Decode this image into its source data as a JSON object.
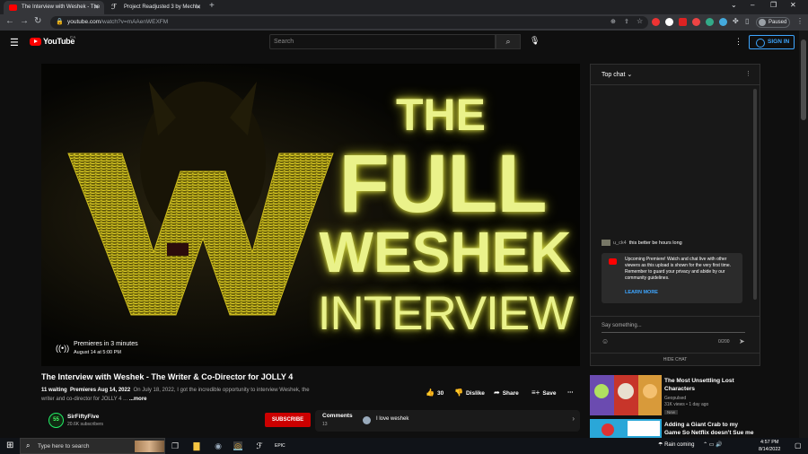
{
  "browser": {
    "tabs": [
      {
        "title": "The Interview with Weshek - The",
        "active": true
      },
      {
        "title": "Project Readjusted 3 by Mechlu",
        "active": false
      }
    ],
    "new_tab": "+",
    "url_host": "youtube.com",
    "url_path": "/watch?v=mAAenWEXFM",
    "profile_label": "Paused",
    "window_controls": [
      "–",
      "❐",
      "✕"
    ]
  },
  "youtube": {
    "logo_text": "YouTube",
    "logo_country": "CA",
    "search_placeholder": "Search",
    "sign_in": "SIGN IN"
  },
  "player": {
    "thumbnail_lines": [
      "THE",
      "FULL",
      "WESHEK",
      "INTERVIEW"
    ],
    "thumbnail_letter": "W",
    "premiere_status": "Premieres in 3 minutes",
    "premiere_time": "August 14 at 5:00 PM"
  },
  "video": {
    "title": "The Interview with Weshek - The Writer & Co-Director for JOLLY 4",
    "waiting": "11 waiting",
    "premieres": "Premieres Aug 14, 2022",
    "description": "On July 18, 2022, I got the incredible opportunity to interview Weshek, the writer and co-director for JOLLY 4 ...",
    "more": "...more",
    "likes": "30",
    "dislike_label": "Dislike",
    "share_label": "Share",
    "save_label": "Save",
    "channel_name": "SirFiftyFive",
    "channel_initials": "55",
    "subscribers": "20.6K subscribers",
    "subscribe_label": "SUBSCRIBE",
    "comments_label": "Comments",
    "comments_count": "13",
    "top_comment": "I love weshek"
  },
  "chat": {
    "header": "Top chat",
    "message_user": "u_ck4",
    "message_text": "this better be hours long",
    "notice": "Upcoming Premiere! Watch and chat live with other viewers as this upload is shown for the very first time. Remember to guard your privacy and abide by our community guidelines.",
    "learn_more": "LEARN MORE",
    "input_placeholder": "Say something...",
    "char_count": "0/200",
    "hide_chat": "HIDE CHAT"
  },
  "related": [
    {
      "title": "The Most Unsettling Lost Characters",
      "channel": "Geopulsed",
      "meta": "31K views • 1 day ago",
      "badge": "New"
    },
    {
      "title": "Adding a Giant Crab to my Game So Netflix doesn't Sue me",
      "channel": "",
      "meta": "",
      "badge": ""
    }
  ],
  "taskbar": {
    "search_placeholder": "Type here to search",
    "weather": "Rain coming",
    "time": "4:57 PM",
    "date": "8/14/2022"
  }
}
